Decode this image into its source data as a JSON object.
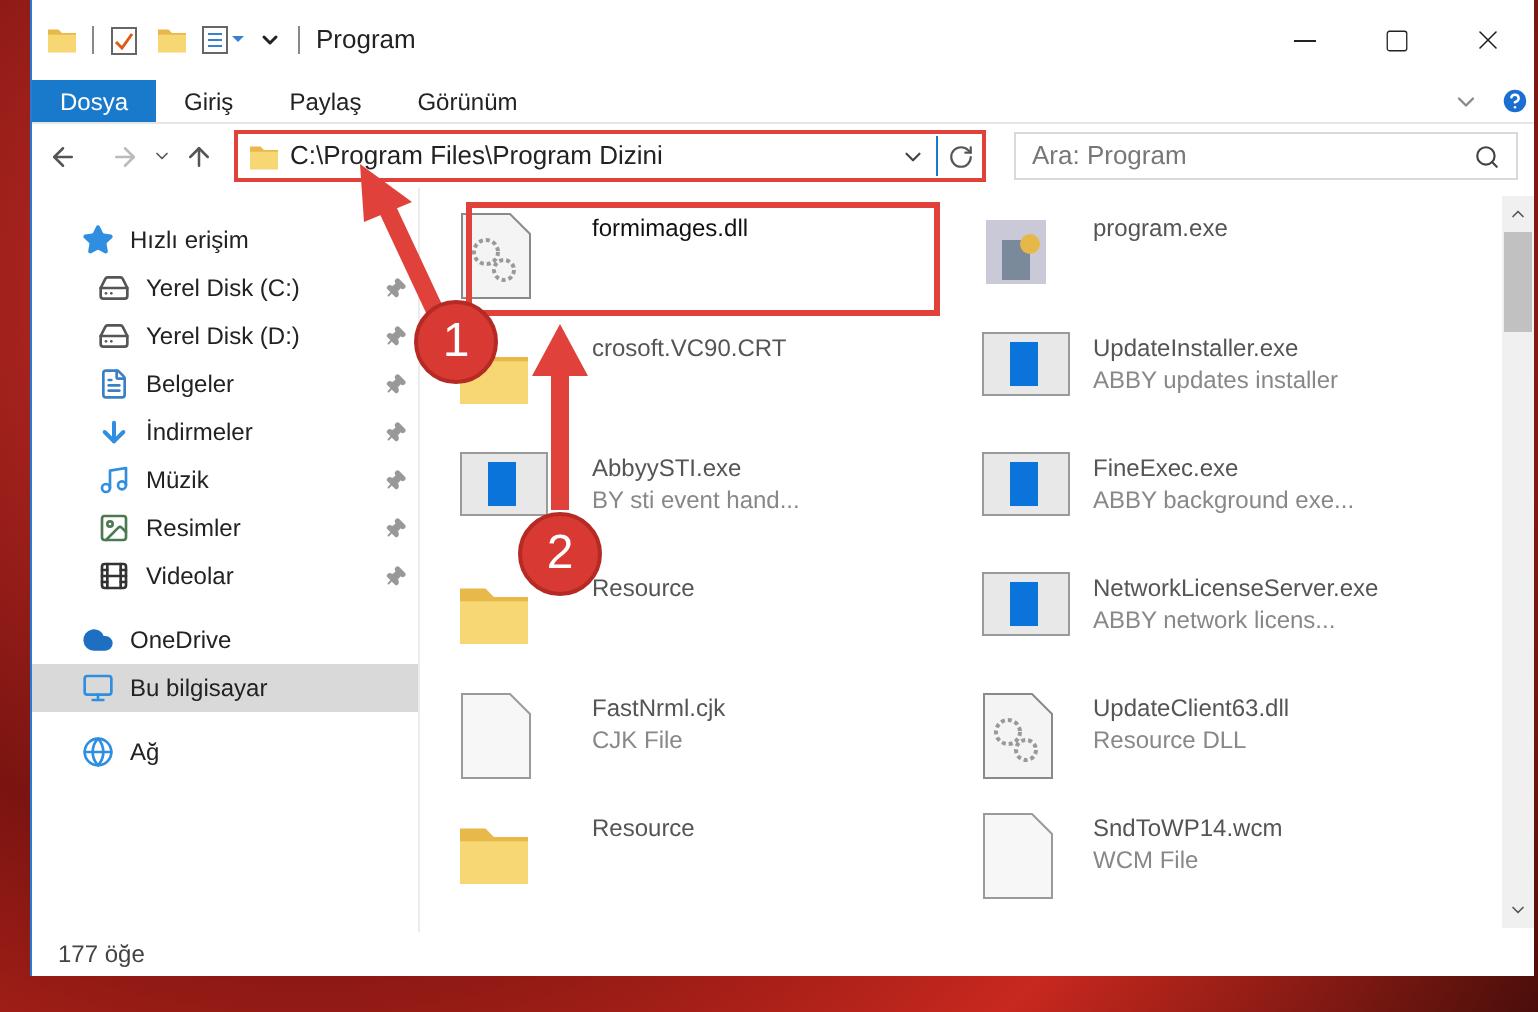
{
  "window": {
    "title": "Program"
  },
  "ribbon_tabs": [
    {
      "label": "Dosya",
      "selected": true
    },
    {
      "label": "Giriş",
      "selected": false
    },
    {
      "label": "Paylaş",
      "selected": false
    },
    {
      "label": "Görünüm",
      "selected": false
    }
  ],
  "address_bar": {
    "path": "C:\\Program Files\\Program Dizini"
  },
  "search": {
    "placeholder": "Ara: Program"
  },
  "sidebar": {
    "items": [
      {
        "label": "Hızlı erişim",
        "kind": "star",
        "pinned": false,
        "selected": false
      },
      {
        "label": "Yerel Disk (C:)",
        "kind": "system-drive",
        "pinned": true,
        "selected": false
      },
      {
        "label": "Yerel Disk (D:)",
        "kind": "drive",
        "pinned": true,
        "selected": false
      },
      {
        "label": "Belgeler",
        "kind": "documents",
        "pinned": true,
        "selected": false
      },
      {
        "label": "İndirmeler",
        "kind": "download",
        "pinned": true,
        "selected": false
      },
      {
        "label": "Müzik",
        "kind": "music",
        "pinned": true,
        "selected": false
      },
      {
        "label": "Resimler",
        "kind": "pictures",
        "pinned": true,
        "selected": false
      },
      {
        "label": "Videolar",
        "kind": "videos",
        "pinned": true,
        "selected": false
      },
      {
        "label": "OneDrive",
        "kind": "cloud",
        "pinned": false,
        "selected": false
      },
      {
        "label": "Bu bilgisayar",
        "kind": "computer",
        "pinned": false,
        "selected": true
      },
      {
        "label": "Ağ",
        "kind": "network",
        "pinned": false,
        "selected": false
      }
    ]
  },
  "files": [
    {
      "name": "formimages.dll",
      "kind": "dll",
      "blurred": false
    },
    {
      "name": "program.exe",
      "kind": "program",
      "blurred": true
    },
    {
      "name": "crosoft.VC90.CRT",
      "kind": "folder",
      "blurred": true
    },
    {
      "name": "UpdateInstaller.exe",
      "description": "ABBY updates installer",
      "kind": "app",
      "blurred": true
    },
    {
      "name": "AbbyySTI.exe",
      "description": "BY sti event hand...",
      "kind": "app",
      "blurred": true
    },
    {
      "name": "FineExec.exe",
      "description": "ABBY background exe...",
      "kind": "app",
      "blurred": true
    },
    {
      "name": "Resource",
      "kind": "folder",
      "blurred": true
    },
    {
      "name": "NetworkLicenseServer.exe",
      "description": "ABBY network licens...",
      "kind": "app",
      "blurred": true
    },
    {
      "name": "FastNrml.cjk",
      "description": "CJK File",
      "kind": "file",
      "blurred": true
    },
    {
      "name": "UpdateClient63.dll",
      "description": "Resource DLL",
      "kind": "dll",
      "blurred": true
    },
    {
      "name": "Resource",
      "kind": "folder",
      "blurred": true
    },
    {
      "name": "SndToWP14.wcm",
      "description": "WCM File",
      "kind": "file",
      "blurred": true
    }
  ],
  "status_bar": {
    "item_count": "177 öğe"
  },
  "annotations": [
    {
      "label": "1"
    },
    {
      "label": "2"
    }
  ]
}
